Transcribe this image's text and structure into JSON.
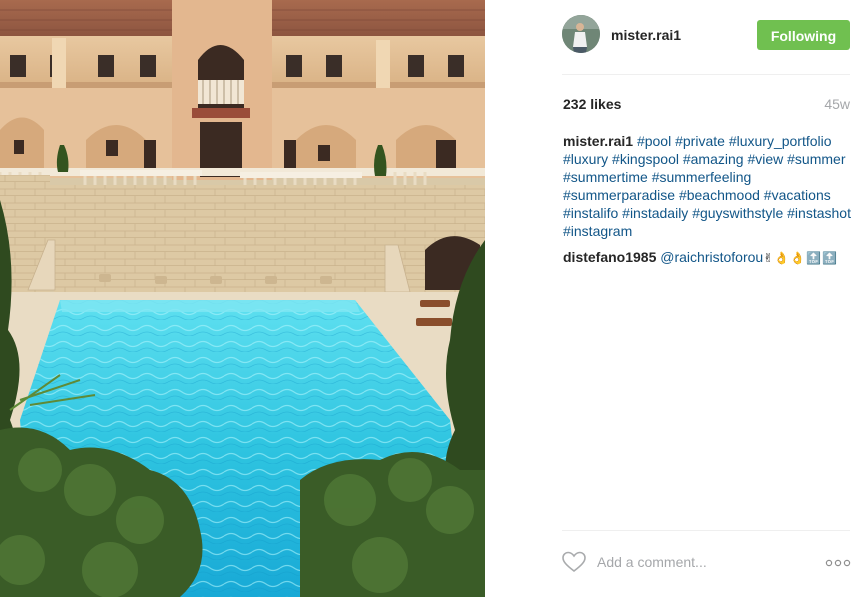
{
  "post": {
    "username": "mister.rai1",
    "follow_label": "Following",
    "likes": "232 likes",
    "timestamp": "45w",
    "colors": {
      "follow_bg": "#70c050",
      "hashtag": "#125688",
      "muted": "#a5a7aa"
    }
  },
  "caption": {
    "username": "mister.rai1",
    "hashtags": [
      "#pool",
      "#private",
      "#luxury_portfolio",
      "#luxury",
      "#kingspool",
      "#amazing",
      "#view",
      "#summer",
      "#summertime",
      "#summerfeeling",
      "#summerparadise",
      "#beachmood",
      "#vacations",
      "#instalifo",
      "#instadaily",
      "#guyswithstyle",
      "#instashot",
      "#instagram"
    ]
  },
  "reply": {
    "username": "distefano1985",
    "mention": "@raichristoforou",
    "emoji": "✌👌👌🔝🔝"
  },
  "comment_box": {
    "placeholder": "Add a comment..."
  },
  "icons": [
    "heart-icon",
    "more-options-icon"
  ]
}
